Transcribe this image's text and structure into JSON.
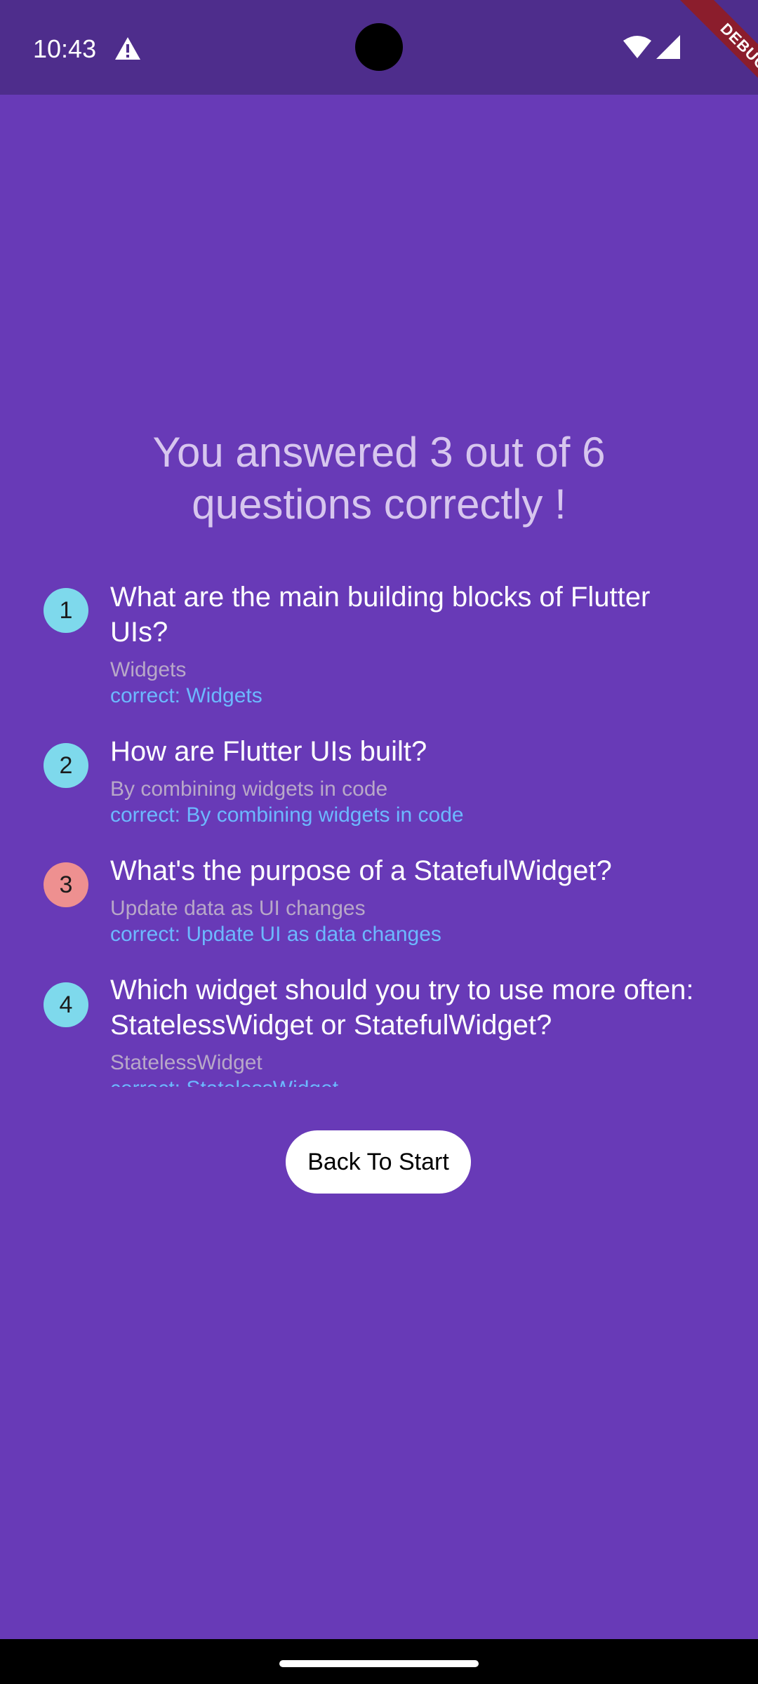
{
  "status_bar": {
    "time": "10:43",
    "debug_label": "DEBUG"
  },
  "summary": {
    "title": "You answered 3 out of 6 questions correctly !",
    "items": [
      {
        "index": "1",
        "question": "What are the main building blocks of Flutter UIs?",
        "user_answer": "Widgets",
        "correct_answer": "correct: Widgets",
        "is_correct": true
      },
      {
        "index": "2",
        "question": "How are Flutter UIs built?",
        "user_answer": "By combining widgets in code",
        "correct_answer": "correct: By combining widgets in code",
        "is_correct": true
      },
      {
        "index": "3",
        "question": "What's the purpose of a StatefulWidget?",
        "user_answer": "Update data as UI changes",
        "correct_answer": "correct: Update UI as data changes",
        "is_correct": false
      },
      {
        "index": "4",
        "question": "Which widget should you try to use more often: StatelessWidget or StatefulWidget?",
        "user_answer": "StatelessWidget",
        "correct_answer": "correct: StatelessWidget",
        "is_correct": true
      }
    ]
  },
  "actions": {
    "back_to_start_label": "Back To Start"
  },
  "colors": {
    "background": "#683ab7",
    "status_bar": "#4e2d8c",
    "title_text": "#d7c6ee",
    "correct_badge": "#7ed9ec",
    "wrong_badge": "#ee9090",
    "user_answer_text": "#b8a8c8",
    "correct_answer_text": "#6cb9ff",
    "debug_ribbon": "#8b1d2c"
  },
  "icons": {
    "status_warning": "warning-icon",
    "status_wifi": "wifi-icon",
    "status_signal": "signal-icon"
  }
}
